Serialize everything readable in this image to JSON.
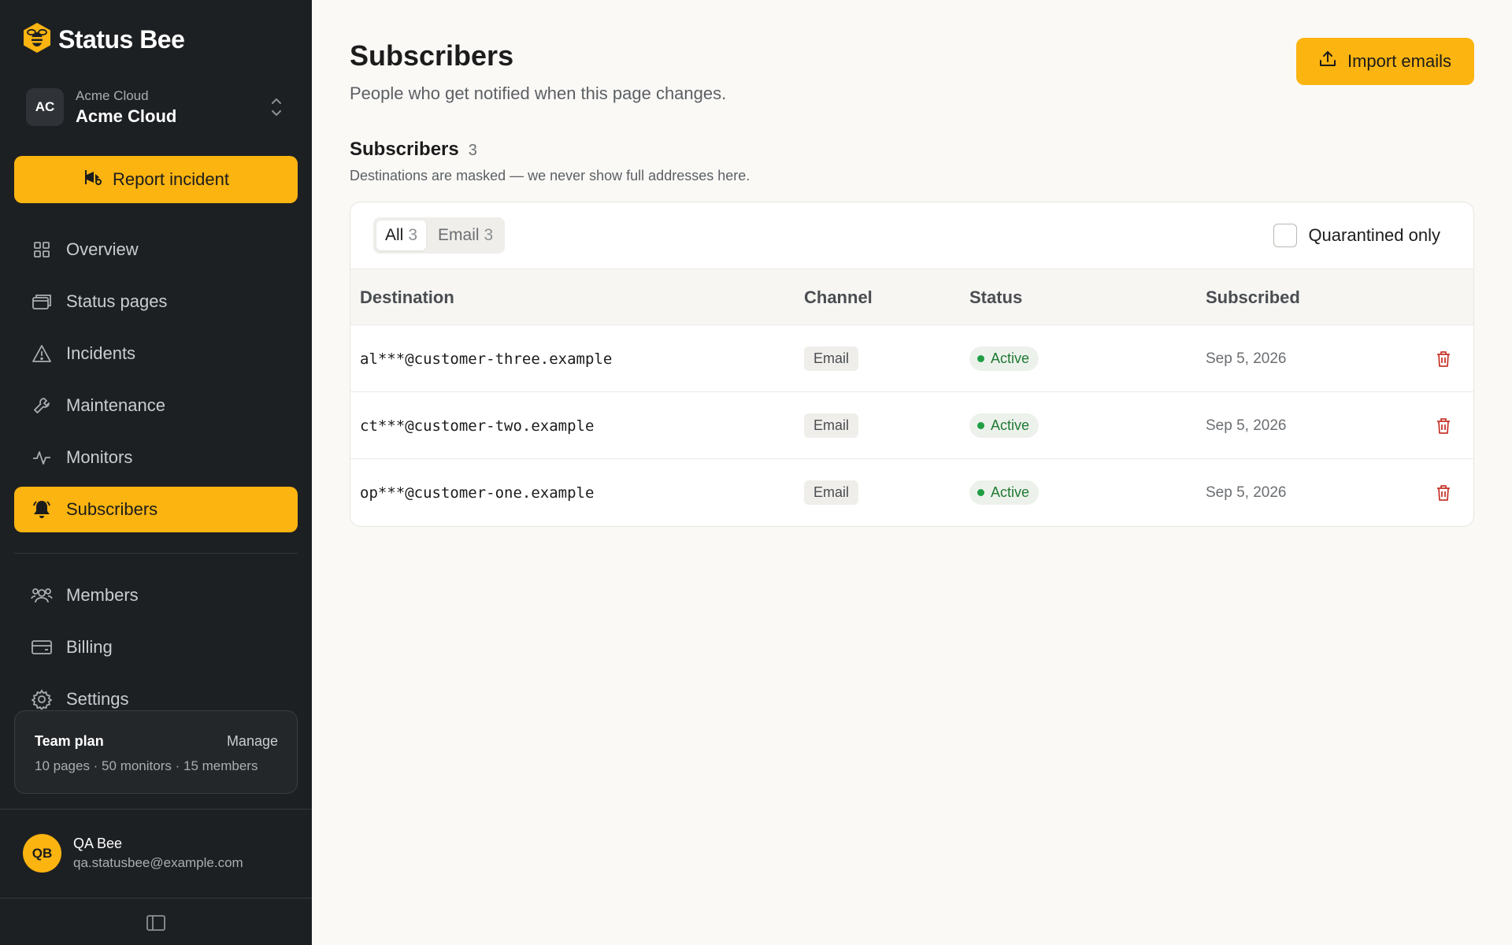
{
  "brand": {
    "name": "Status Bee"
  },
  "org": {
    "initials": "AC",
    "label": "Acme Cloud",
    "name": "Acme Cloud"
  },
  "actions": {
    "report_incident": "Report incident"
  },
  "nav": {
    "items": [
      {
        "label": "Overview",
        "icon": "grid-icon"
      },
      {
        "label": "Status pages",
        "icon": "pages-icon"
      },
      {
        "label": "Incidents",
        "icon": "warning-icon"
      },
      {
        "label": "Maintenance",
        "icon": "wrench-icon"
      },
      {
        "label": "Monitors",
        "icon": "pulse-icon"
      },
      {
        "label": "Subscribers",
        "icon": "bell-icon",
        "active": true
      },
      {
        "label": "Members",
        "icon": "users-icon"
      },
      {
        "label": "Billing",
        "icon": "card-icon"
      },
      {
        "label": "Settings",
        "icon": "gear-icon"
      }
    ]
  },
  "plan": {
    "name": "Team plan",
    "manage": "Manage",
    "limits": "10 pages · 50 monitors · 15 members"
  },
  "user": {
    "initials": "QB",
    "name": "QA Bee",
    "email": "qa.statusbee@example.com"
  },
  "page": {
    "title": "Subscribers",
    "subtitle": "People who get notified when this page changes.",
    "import_label": "Import emails"
  },
  "section": {
    "title": "Subscribers",
    "count": "3",
    "subtitle": "Destinations are masked — we never show full addresses here."
  },
  "filters": {
    "tabs": [
      {
        "label": "All",
        "count": "3",
        "active": true
      },
      {
        "label": "Email",
        "count": "3"
      }
    ],
    "quarantined_label": "Quarantined only",
    "quarantined_checked": false
  },
  "table": {
    "headers": {
      "destination": "Destination",
      "channel": "Channel",
      "status": "Status",
      "subscribed": "Subscribed"
    },
    "rows": [
      {
        "destination": "al***@customer-three.example",
        "channel": "Email",
        "status": "Active",
        "subscribed": "Sep 5, 2026"
      },
      {
        "destination": "ct***@customer-two.example",
        "channel": "Email",
        "status": "Active",
        "subscribed": "Sep 5, 2026"
      },
      {
        "destination": "op***@customer-one.example",
        "channel": "Email",
        "status": "Active",
        "subscribed": "Sep 5, 2026"
      }
    ]
  },
  "colors": {
    "accent": "#fbb410",
    "sidebar": "#1d2023",
    "background": "#faf9f6",
    "success": "#1f7a35",
    "danger": "#c8372d"
  }
}
